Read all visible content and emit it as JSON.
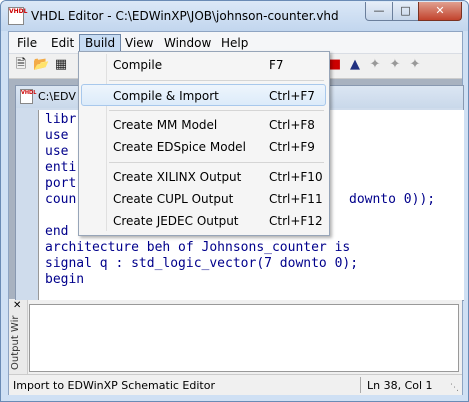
{
  "window": {
    "title": "VHDL Editor - C:\\EDWinXP\\JOB\\johnson-counter.vhd"
  },
  "menubar": [
    "File",
    "Edit",
    "Build",
    "View",
    "Window",
    "Help"
  ],
  "build_menu": {
    "items": [
      {
        "label": "Compile",
        "shortcut": "F7"
      },
      {
        "label": "Compile & Import",
        "shortcut": "Ctrl+F7"
      },
      {
        "label": "Create MM Model",
        "shortcut": "Ctrl+F8"
      },
      {
        "label": "Create EDSpice Model",
        "shortcut": "Ctrl+F9"
      },
      {
        "label": "Create XILINX Output",
        "shortcut": "Ctrl+F10"
      },
      {
        "label": "Create CUPL Output",
        "shortcut": "Ctrl+F11"
      },
      {
        "label": "Create JEDEC Output",
        "shortcut": "Ctrl+F12"
      }
    ]
  },
  "document": {
    "title": "C:\\EDV",
    "code_lines": [
      "libr",
      "use",
      "use",
      "enti",
      "port",
      "coun",
      "end",
      "architecture beh of Johnsons_counter is",
      "signal q : std_logic_vector(7 downto 0);",
      "begin"
    ],
    "visible_fragment": "downto 0));"
  },
  "output": {
    "label": "Output Wir"
  },
  "statusbar": {
    "message": "Import to EDWinXP Schematic Editor",
    "position": "Ln 38, Col 1"
  },
  "colors": {
    "keyword": "#00008b",
    "menu_highlight": "#c7dcf3"
  }
}
